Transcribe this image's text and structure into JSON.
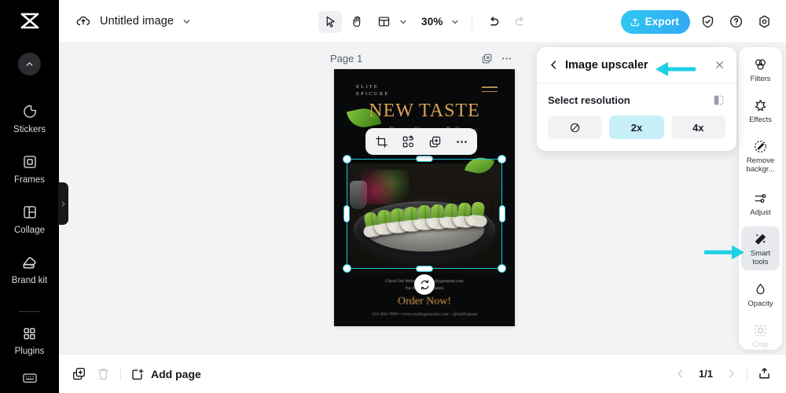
{
  "app": {
    "logo_name": "capcut-logo",
    "doc_title": "Untitled image"
  },
  "toolbar": {
    "select_tool": "select-tool",
    "hand_tool": "hand-tool",
    "layout_tool": "layout-tool",
    "zoom_value": "30%",
    "undo_label": "undo",
    "redo_label": "redo",
    "export_label": "Export",
    "shield_label": "shield",
    "help_label": "help",
    "settings_label": "settings"
  },
  "left_rail": {
    "scroll_up": "scroll-up",
    "items": [
      {
        "label": "Stickers",
        "icon": "sticker-icon"
      },
      {
        "label": "Frames",
        "icon": "frame-icon"
      },
      {
        "label": "Collage",
        "icon": "collage-icon"
      },
      {
        "label": "Brand kit",
        "icon": "brand-kit-icon"
      },
      {
        "label": "Plugins",
        "icon": "plugins-icon"
      }
    ],
    "bottom_icon": "keyboard-shortcuts-icon",
    "collapse": "collapse-sidebar"
  },
  "canvas": {
    "page_label": "Page 1",
    "duplicate_page_icon": "duplicate-page-icon",
    "more_icon": "more-options-icon",
    "element_toolbar": [
      {
        "icon": "crop-icon",
        "name": "crop-button"
      },
      {
        "icon": "smart-cutout-icon",
        "name": "cutout-button"
      },
      {
        "icon": "duplicate-icon",
        "name": "duplicate-button"
      },
      {
        "icon": "more-icon",
        "name": "more-button"
      }
    ],
    "rotate_handle": "rotate-handle"
  },
  "poster": {
    "brand": "ELITE\nEPICURE",
    "title": "NEW TASTE",
    "subtitle": "Dragon Signature Roll",
    "body": "Check Our Website www.reallygreatsite.com\nFor More Information",
    "cta": "Order Now!",
    "footer": "123-456-7890  •  www.reallygreatsite.com  •  @reallygreat"
  },
  "panel": {
    "back_icon": "back-chevron-icon",
    "title": "Image upscaler",
    "close_icon": "close-icon",
    "section_label": "Select resolution",
    "compare_icon": "compare-icon",
    "options": [
      {
        "label": "",
        "icon": "none-prohibited-icon",
        "name": "resolution-none",
        "selected": false
      },
      {
        "label": "2x",
        "icon": "",
        "name": "resolution-2x",
        "selected": true
      },
      {
        "label": "4x",
        "icon": "",
        "name": "resolution-4x",
        "selected": false
      }
    ]
  },
  "right_rail": {
    "items": [
      {
        "label": "Filters",
        "icon": "filters-icon",
        "state": "normal"
      },
      {
        "label": "Effects",
        "icon": "effects-icon",
        "state": "normal"
      },
      {
        "label": "Remove backgr...",
        "icon": "remove-background-icon",
        "state": "normal"
      },
      {
        "label": "Adjust",
        "icon": "adjust-icon",
        "state": "normal"
      },
      {
        "label": "Smart tools",
        "icon": "smart-tools-icon",
        "state": "active"
      },
      {
        "label": "Opacity",
        "icon": "opacity-icon",
        "state": "normal"
      },
      {
        "label": "Crop",
        "icon": "crop-icon",
        "state": "disabled"
      }
    ]
  },
  "bottombar": {
    "duplicate_icon": "duplicate-page-icon",
    "delete_icon": "delete-page-icon",
    "add_page_label": "Add page",
    "add_page_icon": "add-page-icon",
    "prev_icon": "previous-page-icon",
    "page_indicator": "1/1",
    "next_icon": "next-page-icon",
    "upload_icon": "upload-icon"
  },
  "annotations": {
    "arrow_color": "#1ed0e6",
    "arrow_1_target": "Image upscaler",
    "arrow_2_target": "Smart tools"
  }
}
